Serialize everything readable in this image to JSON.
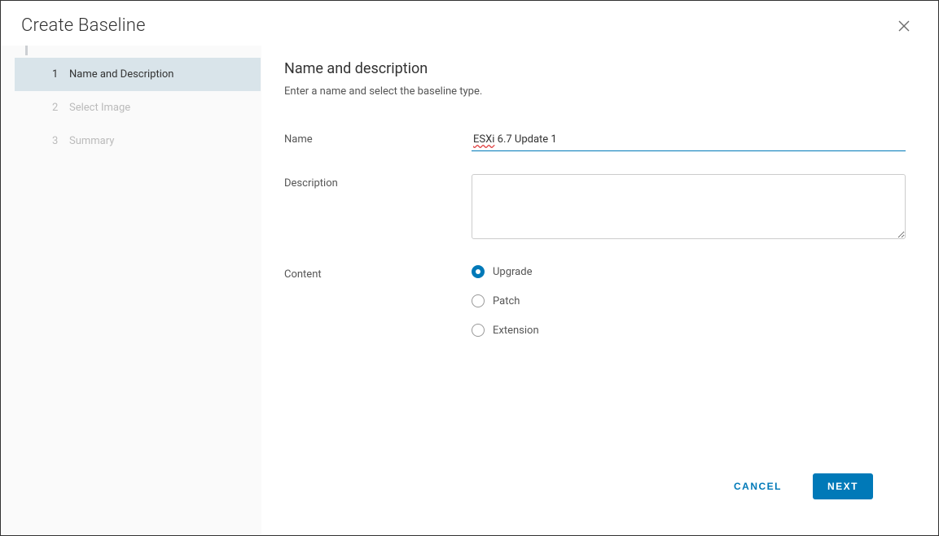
{
  "dialog": {
    "title": "Create Baseline"
  },
  "wizard": {
    "steps": [
      {
        "number": "1",
        "label": "Name and Description",
        "active": true
      },
      {
        "number": "2",
        "label": "Select Image",
        "active": false
      },
      {
        "number": "3",
        "label": "Summary",
        "active": false
      }
    ]
  },
  "section": {
    "title": "Name and description",
    "subtitle": "Enter a name and select the baseline type."
  },
  "form": {
    "name_label": "Name",
    "name_value_prefix": "ESXi",
    "name_value_suffix": " 6.7 Update 1",
    "description_label": "Description",
    "description_value": "",
    "content_label": "Content",
    "radio_options": [
      {
        "label": "Upgrade",
        "selected": true
      },
      {
        "label": "Patch",
        "selected": false
      },
      {
        "label": "Extension",
        "selected": false
      }
    ]
  },
  "footer": {
    "cancel": "CANCEL",
    "next": "NEXT"
  }
}
